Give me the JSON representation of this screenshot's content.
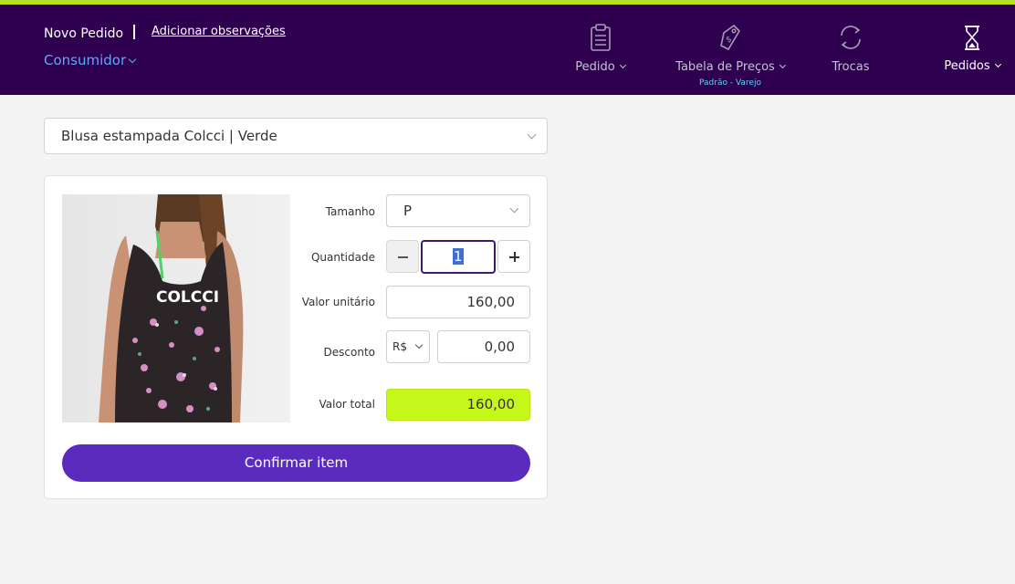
{
  "header": {
    "title": "Novo Pedido",
    "notes_link": "Adicionar observações",
    "customer_label": "Consumidor",
    "nav": [
      {
        "label": "Pedido",
        "icon": "clipboard-icon"
      },
      {
        "label": "Tabela de Preços",
        "sub": "Padrão - Varejo",
        "icon": "price-tag-icon"
      },
      {
        "label": "Trocas",
        "icon": "exchange-icon"
      },
      {
        "label": "Pedidos",
        "icon": "hourglass-icon"
      }
    ]
  },
  "product": {
    "selected": "Blusa estampada Colcci | Verde",
    "print_text": "COLCCI",
    "fields": {
      "size_label": "Tamanho",
      "size_value": "P",
      "qty_label": "Quantidade",
      "qty_value": "1",
      "unit_price_label": "Valor unitário",
      "unit_price_value": "160,00",
      "discount_label": "Desconto",
      "discount_currency": "R$",
      "discount_value": "0,00",
      "total_label": "Valor total",
      "total_value": "160,00"
    },
    "confirm_label": "Confirmar item"
  },
  "colors": {
    "header_bg": "#2e004f",
    "accent": "#b5e31d",
    "primary_button": "#5a2bbd",
    "total_bg": "#c6f71a",
    "link_blue": "#5fa8ff"
  }
}
